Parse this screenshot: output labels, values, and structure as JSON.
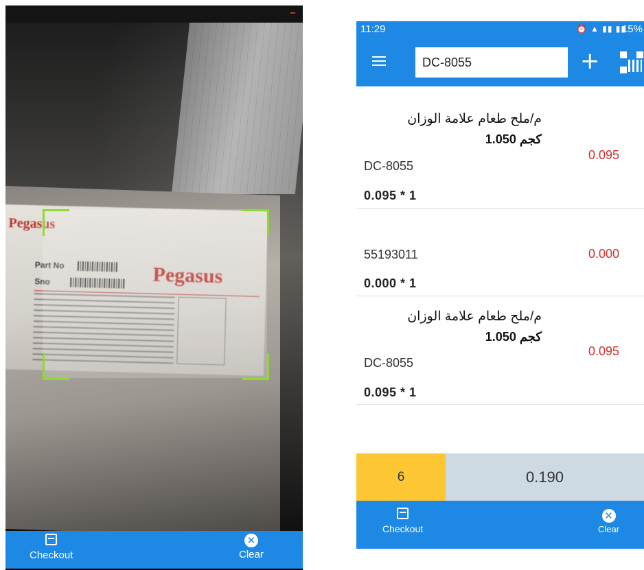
{
  "scanner_screen": {
    "label": {
      "brand_small": "Pegasus",
      "brand_large": "Pegasus",
      "part_no_label": "Part No",
      "sno_label": "Sno"
    },
    "bottom_nav": {
      "checkout_label": "Checkout",
      "clear_label": "Clear"
    }
  },
  "app_screen": {
    "status_bar": {
      "time": "11:29",
      "battery": "15%"
    },
    "app_bar": {
      "search_value": "DC-8055",
      "plus_symbol": "+"
    },
    "items": [
      {
        "name": "م/ملح طعام علامة الوزان",
        "weight": "1.050 كجم",
        "code": "DC-8055",
        "qty_line": "0.095 * 1",
        "price": "0.095"
      },
      {
        "name": "",
        "weight": "",
        "code": "55193011",
        "qty_line": "0.000 * 1",
        "price": "0.000"
      },
      {
        "name": "م/ملح طعام علامة الوزان",
        "weight": "1.050 كجم",
        "code": "DC-8055",
        "qty_line": "0.095 * 1",
        "price": "0.095"
      }
    ],
    "summary": {
      "count": "6",
      "total": "0.190"
    },
    "bottom_nav": {
      "checkout_label": "Checkout",
      "clear_label": "Clear"
    },
    "colors": {
      "primary": "#1e88e5",
      "price_red": "#d32f2f",
      "count_yellow": "#fdc733",
      "total_bg": "#cdd9e3"
    }
  }
}
